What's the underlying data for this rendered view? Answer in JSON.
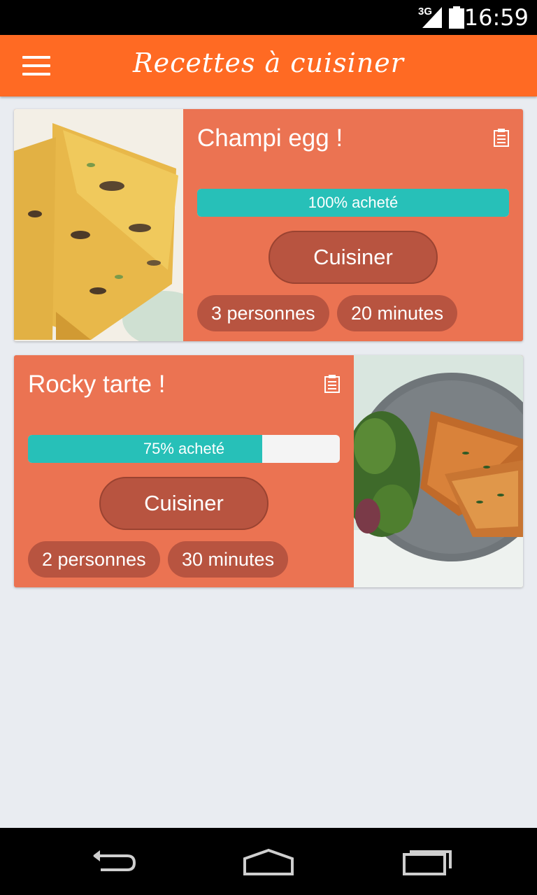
{
  "status_bar": {
    "network": "3G",
    "time": "16:59"
  },
  "app_bar": {
    "title": "Recettes à cuisiner"
  },
  "recipes": [
    {
      "title": "Champi egg !",
      "progress": 1.0,
      "progress_label": "100% acheté",
      "cook_label": "Cuisiner",
      "persons": "3 personnes",
      "duration": "20 minutes"
    },
    {
      "title": "Rocky tarte !",
      "progress": 0.75,
      "progress_label": "75% acheté",
      "cook_label": "Cuisiner",
      "persons": "2 personnes",
      "duration": "30 minutes"
    }
  ],
  "colors": {
    "app_bar": "#ff6a23",
    "card": "#eb7352",
    "button": "#b85440",
    "progress": "#27c0b8",
    "background": "#e9ecf1"
  }
}
